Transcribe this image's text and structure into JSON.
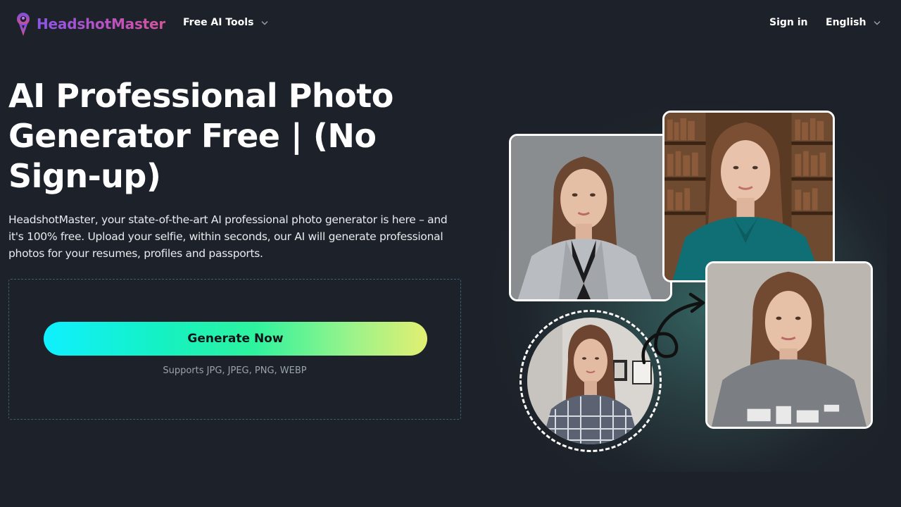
{
  "header": {
    "brand": "HeadshotMaster",
    "nav_tools_label": "Free AI Tools",
    "signin_label": "Sign in",
    "language_label": "English"
  },
  "hero": {
    "title": "AI Professional Photo Generator Free | (No Sign-up)",
    "description": "HeadshotMaster, your state-of-the-art AI professional photo generator is here – and it's 100% free. Upload your selfie, within seconds, our AI will generate professional photos for your resumes, profiles and passports."
  },
  "upload": {
    "button_label": "Generate Now",
    "supports_text": "Supports JPG, JPEG, PNG, WEBP"
  },
  "colors": {
    "background": "#1d2129",
    "brand_start": "#8a55e8",
    "brand_end": "#d4549a",
    "button_gradient_start": "#10f0ff",
    "button_gradient_end": "#e2ef72"
  },
  "icons": {
    "logo": "headshot-pin-logo-icon",
    "dropdown": "chevron-down-icon",
    "arrow": "curved-arrow-icon"
  }
}
